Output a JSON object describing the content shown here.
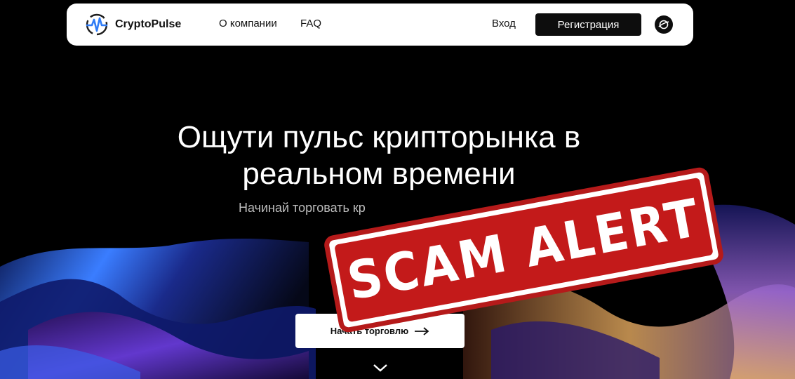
{
  "navbar": {
    "logo_text": "CryptoPulse",
    "links": [
      "О компании",
      "FAQ"
    ],
    "login_label": "Вход",
    "register_label": "Регистрация",
    "language_icon": "globe-icon"
  },
  "hero": {
    "title": "Ощути пульс крипторынка в реальном времени",
    "subtitle": "Начинай торговать кр",
    "cta_label": "Начать торговлю",
    "cta_icon": "arrow-right-icon",
    "scroll_icon": "chevron-down-icon"
  },
  "stamp": {
    "text": "SCAM ALERT"
  },
  "colors": {
    "stamp_red": "#c31a1a",
    "nav_bg": "#ffffff",
    "page_bg": "#000000"
  }
}
